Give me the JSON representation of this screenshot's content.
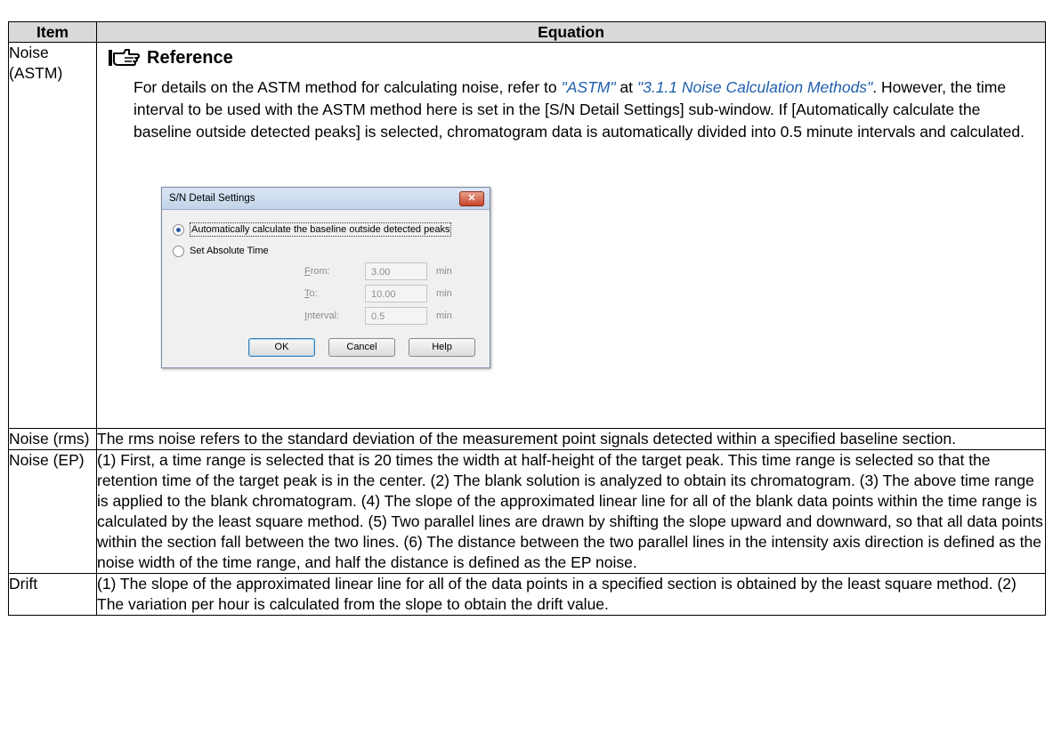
{
  "table": {
    "headers": {
      "item": "Item",
      "equation": "Equation"
    },
    "rows": {
      "astm": {
        "item": "Noise (ASTM)",
        "ref_title": "Reference",
        "body": {
          "p1": "For details on the ASTM method for calculating noise, refer to ",
          "link1": "\"ASTM\"",
          "p2": " at ",
          "link2": "\"3.1.1 Noise Calculation Methods\"",
          "p3": ". However, the time interval to be used with the ASTM method here is set in the [S/N Detail Settings] sub-window. If [Automatically calculate the baseline outside detected peaks] is selected, chromatogram data is automatically divided into 0.5 minute intervals and calculated."
        },
        "dialog": {
          "title": "S/N Detail Settings",
          "close_glyph": "✕",
          "option_auto": "Automatically calculate the baseline outside detected peaks",
          "option_abs": "Set Absolute Time",
          "fields": {
            "from": {
              "accel": "F",
              "rest": "rom:",
              "value": "3.00",
              "unit": "min"
            },
            "to": {
              "accel": "T",
              "rest": "o:",
              "value": "10.00",
              "unit": "min"
            },
            "interval": {
              "accel": "I",
              "rest": "nterval:",
              "value": "0.5",
              "unit": "min"
            }
          },
          "buttons": {
            "ok": "OK",
            "cancel": "Cancel",
            "help": "Help"
          }
        }
      },
      "rms": {
        "item": "Noise (rms)",
        "text": "The rms noise refers to the standard deviation of the measurement point signals detected within a specified baseline section."
      },
      "ep": {
        "item": "Noise (EP)",
        "text": "(1) First, a time range is selected that is 20 times the width at half-height of the target peak. This time range is selected so that the retention time of the target peak is in the center. (2) The blank solution is analyzed to obtain its chromatogram. (3) The above time range is applied to the blank chromatogram. (4) The slope of the approximated linear line for all of the blank data points within the time range is calculated by the least square method. (5) Two parallel lines are drawn by shifting the slope upward and downward, so that all data points within the section fall between the two lines. (6) The distance between the two parallel lines in the intensity axis direction is defined as the noise width of the time range, and half the distance is defined as the EP noise."
      },
      "drift": {
        "item": "Drift",
        "text": "(1) The slope of the approximated linear line for all of the data points in a specified section is obtained by the least square method. (2) The variation per hour is calculated from the slope to obtain the drift value."
      }
    }
  }
}
